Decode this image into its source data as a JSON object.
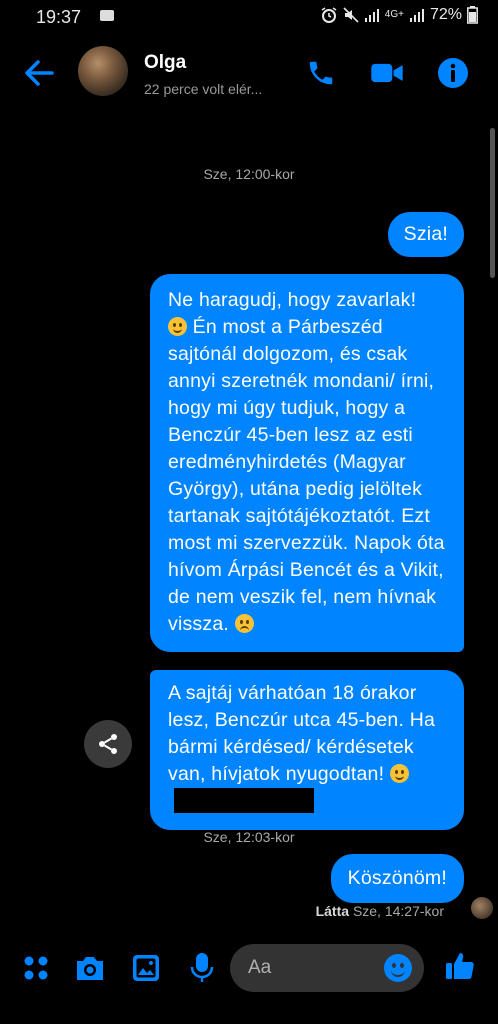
{
  "status_bar": {
    "time": "19:37",
    "network": "4G+",
    "battery": "72%"
  },
  "header": {
    "name": "Olga",
    "status": "22 perce volt elér..."
  },
  "messages": {
    "ts1": "Sze, 12:00-kor",
    "m1": "Szia!",
    "m2_a": "Ne haragudj, hogy zavarlak!",
    "m2_b": "Én most a Párbeszéd sajtónál dolgozom, és csak annyi szeretnék mondani/ írni, hogy mi úgy tudjuk, hogy a Benczúr 45-ben lesz az esti eredményhirdetés (Magyar György), utána pedig jelöltek tartanak sajtótájékoztatót. Ezt most mi szervezzük. Napok óta hívom Árpási Bencét és a Vikit, de nem veszik fel, nem hívnak vissza.",
    "m3": "A sajtáj várhatóan 18 órakor lesz, Benczúr utca 45-ben. Ha bármi kérdésed/ kérdésetek van, hívjatok nyugodtan!",
    "ts2": "Sze, 12:03-kor",
    "m4": "Köszönöm!",
    "seen_label": "Látta",
    "seen_time": "Sze, 14:27-kor"
  },
  "composer": {
    "placeholder": "Aa"
  },
  "colors": {
    "accent": "#0084ff",
    "background": "#000000",
    "input_bg": "#333333"
  },
  "icons": [
    "back-arrow-icon",
    "phone-icon",
    "video-icon",
    "info-icon",
    "share-icon",
    "apps-icon",
    "camera-icon",
    "gallery-icon",
    "mic-icon",
    "emoji-icon",
    "like-icon"
  ]
}
